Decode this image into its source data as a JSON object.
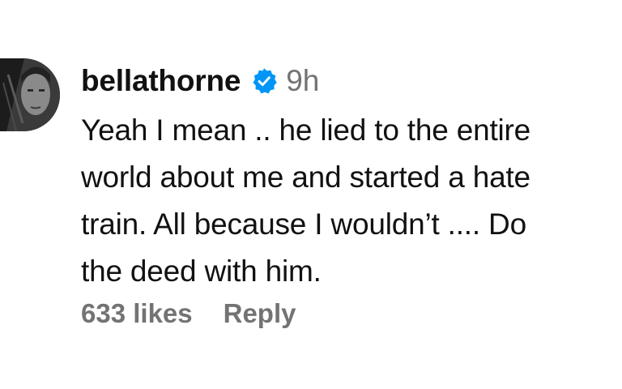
{
  "comment": {
    "username": "bellathorne",
    "verified_icon": "verified-badge-icon",
    "time": "9h",
    "text": "Yeah I mean .. he lied to the entire\nworld about me and started a hate\ntrain. All because I wouldn’t .... Do\nthe deed with him.",
    "likes": "633 likes",
    "reply_label": "Reply"
  },
  "colors": {
    "verified_blue": "#0095f6",
    "secondary_text": "#737373",
    "primary_text": "#111111"
  }
}
